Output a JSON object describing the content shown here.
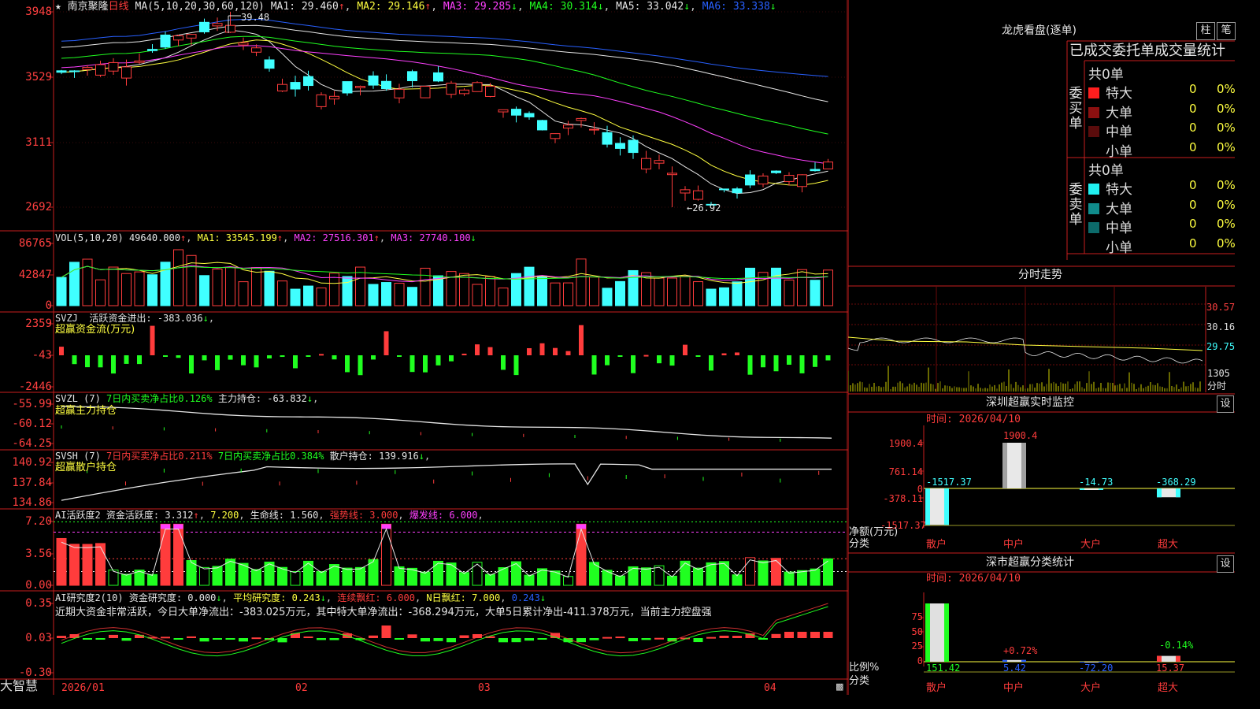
{
  "colors": {
    "up": "#ff3c3c",
    "down": "#40ffff",
    "panel_border": "#c81e1e"
  },
  "stock": {
    "name": "南京聚隆",
    "period": "日线",
    "star": "★"
  },
  "main_panel": {
    "ma_label": "MA(5,10,20,30,60,120)",
    "ma": [
      {
        "name": "MA1",
        "value": "29.460",
        "arrow": "↑",
        "color": "#e6e6e6"
      },
      {
        "name": "MA2",
        "value": "29.146",
        "arrow": "↑",
        "color": "#ffff40"
      },
      {
        "name": "MA3",
        "value": "29.285",
        "arrow": "↓",
        "color": "#ff40ff"
      },
      {
        "name": "MA4",
        "value": "30.314",
        "arrow": "↓",
        "color": "#20ff20"
      },
      {
        "name": "MA5",
        "value": "33.042",
        "arrow": "↓",
        "color": "#e6e6e6"
      },
      {
        "name": "MA6",
        "value": "33.338",
        "arrow": "↓",
        "color": "#2860ff"
      }
    ],
    "y_ticks": [
      "3948",
      "3529",
      "3111",
      "2692"
    ],
    "high_label": "39.48",
    "low_label": "←26.92"
  },
  "vol_panel": {
    "label": "VOL(5,10,20)",
    "value": "49640.000",
    "ma1": "33545.199",
    "ma2": "27516.301",
    "ma3": "27740.100",
    "y_ticks": [
      "86765",
      "42847",
      "0"
    ]
  },
  "svzj_panel": {
    "label": "SVZJ",
    "title": "活跃资金进出:",
    "value": "-383.036",
    "sub": "超赢资金流(万元)",
    "y_ticks": [
      "2359",
      "-43",
      "-2446"
    ]
  },
  "svzl_panel": {
    "label": "SVZL (7)",
    "t1": "7日内买卖净占比0.126%",
    "t2": "主力持仓:",
    "value": "-63.832",
    "sub": "超赢主力持仓",
    "y_ticks": [
      "-55.99",
      "-60.12",
      "-64.25"
    ]
  },
  "svsh_panel": {
    "label": "SVSH (7)",
    "t1": "7日内买卖净占比0.211%",
    "t2": "7日内买卖净占比0.384%",
    "t3": "散户持仓:",
    "value": "139.916",
    "sub": "超赢散户持仓",
    "y_ticks": [
      "140.92",
      "137.84",
      "134.86"
    ]
  },
  "ai1_panel": {
    "label": "AI活跃度2",
    "t1": "资金活跃度:",
    "v1": "3.312",
    "v2": "7.200",
    "t3": "生命线:",
    "v3": "1.560",
    "t4": "强势线:",
    "v4": "3.000",
    "t5": "爆发线:",
    "v5": "6.000",
    "y_ticks": [
      "7.20",
      "3.56",
      "0.00"
    ]
  },
  "ai2_panel": {
    "label": "AI研究度2(10)",
    "t1": "资金研究度:",
    "v1": "0.000",
    "t2": "平均研究度:",
    "v2": "0.243",
    "t3": "连续飘红:",
    "v3": "6.000",
    "t4": "N日飘红:",
    "v4": "7.000",
    "v5": "0.243",
    "comment": "近期大资金非常活跃，今日大单净流出：-383.025万元，其中特大单净流出：-368.294万元，大单5日累计净出-411.378万元，当前主力控盘强",
    "y_ticks": [
      "0.35",
      "0.03",
      "-0.30"
    ]
  },
  "x_axis": {
    "labels": [
      "2026/01",
      "02",
      "03",
      "04"
    ]
  },
  "brand": "大智慧",
  "right": {
    "lhb_title": "龙虎看盘(逐单)",
    "btn_zhu": "柱",
    "btn_bi": "笔",
    "stats_title": "已成交委托单成交量统计",
    "buy": {
      "vertical": "委买单",
      "total": "共0单",
      "rows": [
        {
          "label": "特大",
          "n": "0",
          "p": "0%",
          "color": "#ff1e1e"
        },
        {
          "label": "大单",
          "n": "0",
          "p": "0%",
          "color": "#8c1010"
        },
        {
          "label": "中单",
          "n": "0",
          "p": "0%",
          "color": "#5a0c0c"
        },
        {
          "label": "小单",
          "n": "0",
          "p": "0%",
          "color": ""
        }
      ]
    },
    "sell": {
      "vertical": "委卖单",
      "total": "共0单",
      "rows": [
        {
          "label": "特大",
          "n": "0",
          "p": "0%",
          "color": "#20f0f0"
        },
        {
          "label": "大单",
          "n": "0",
          "p": "0%",
          "color": "#108c8c"
        },
        {
          "label": "中单",
          "n": "0",
          "p": "0%",
          "color": "#0c6a6a"
        },
        {
          "label": "小单",
          "n": "0",
          "p": "0%",
          "color": ""
        }
      ]
    },
    "intraday": {
      "title": "分时走势",
      "y_labels": [
        "30.57",
        "30.16",
        "29.75"
      ],
      "vol_label": "1305",
      "fen": "分时"
    },
    "sz_monitor": {
      "title": "深圳超赢实时监控",
      "btn": "设",
      "time": "时间: 2026/04/10",
      "y_ticks": [
        "1900.4",
        "761.14",
        "0",
        "-378.11",
        "-1517.37"
      ],
      "ylabel": "净额(万元)",
      "xlabel": "分类",
      "cats": [
        "散户",
        "中户",
        "大户",
        "超大"
      ],
      "values": [
        "-1517.37",
        "1900.4",
        "-14.73",
        "-368.29"
      ]
    },
    "sz_class": {
      "title": "深市超赢分类统计",
      "btn": "设",
      "time": "时间: 2026/04/10",
      "y_ticks": [
        "75",
        "50",
        "25",
        "0"
      ],
      "ylabel": "比例%",
      "xlabel": "分类",
      "cats": [
        "散户",
        "中户",
        "大户",
        "超大"
      ],
      "values": [
        "151.42",
        "5.42",
        "-72.20",
        "15.37"
      ],
      "pcts": [
        "+0.72%",
        "-0.14%"
      ]
    }
  },
  "chart_data": [
    {
      "type": "candlestick",
      "title": "南京聚隆 日线",
      "x": [
        "2026/01",
        "02",
        "03",
        "04"
      ],
      "ma": {
        "MA1": 29.46,
        "MA2": 29.146,
        "MA3": 29.285,
        "MA4": 30.314,
        "MA5": 33.042,
        "MA6": 33.338
      },
      "ylim": [
        26.9,
        39.5
      ],
      "y_tick_labels": [
        "3948",
        "3529",
        "3111",
        "2692"
      ],
      "high": 39.48,
      "low": 26.92
    },
    {
      "type": "bar",
      "title": "VOL(5,10,20)",
      "ylim": [
        0,
        86765
      ],
      "last": 49640.0
    },
    {
      "type": "bar",
      "title": "SVZJ",
      "ylim": [
        -2446,
        2359
      ],
      "last": -383.036
    },
    {
      "type": "line",
      "title": "SVZL",
      "ylim": [
        -64.25,
        -55.99
      ],
      "last": -63.832
    },
    {
      "type": "line",
      "title": "SVSH",
      "ylim": [
        134.86,
        140.92
      ],
      "last": 139.916
    },
    {
      "type": "bar",
      "title": "AI活跃度2",
      "ylim": [
        0,
        7.2
      ],
      "last": 3.312
    },
    {
      "type": "bar",
      "title": "AI研究度2(10)",
      "ylim": [
        -0.3,
        0.35
      ],
      "last": 0.0
    },
    {
      "type": "bar",
      "title": "深圳超赢实时监控",
      "categories": [
        "散户",
        "中户",
        "大户",
        "超大"
      ],
      "values": [
        -1517.37,
        1900.4,
        -14.73,
        -368.29
      ]
    },
    {
      "type": "bar",
      "title": "深市超赢分类统计",
      "categories": [
        "散户",
        "中户",
        "大户",
        "超大"
      ],
      "values": [
        151.42,
        5.42,
        -72.2,
        15.37
      ]
    }
  ]
}
